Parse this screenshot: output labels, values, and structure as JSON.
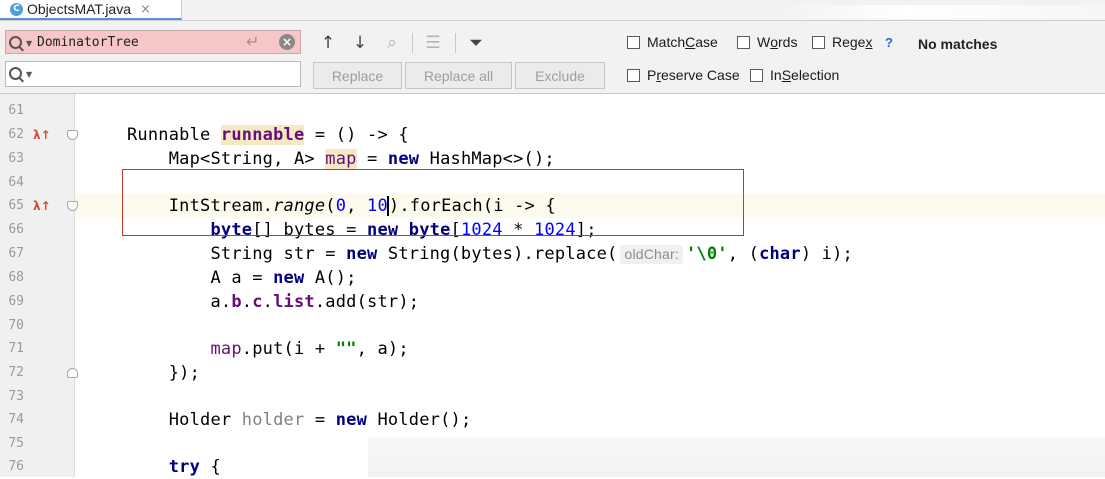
{
  "tab": {
    "file_icon_letter": "C",
    "title": "ObjectsMAT.java",
    "close_glyph": "×",
    "icon": "java-class-icon"
  },
  "find": {
    "search_value": "DominatorTree",
    "replace_value": "",
    "enter_glyph": "↵",
    "clear_glyph": "×",
    "tools": {
      "prev_glyph": "↑",
      "next_glyph": "↓",
      "find_all_glyph": "⌕",
      "select_all_glyph": "☰",
      "filter_glyph": "⏷"
    },
    "replace_label": "Replace",
    "replace_all_label": "Replace all",
    "exclude_label": "Exclude",
    "options": {
      "match_case": {
        "pre": "Match ",
        "u": "C",
        "post": "ase"
      },
      "words": {
        "pre": "W",
        "u": "o",
        "post": "rds"
      },
      "regex": {
        "pre": "Rege",
        "u": "x",
        "post": ""
      },
      "preserve_case": {
        "pre": "P",
        "u": "r",
        "post": "eserve Case"
      },
      "in_selection": {
        "pre": "In ",
        "u": "S",
        "post": "election"
      }
    },
    "regex_help": "?",
    "status": "No matches"
  },
  "gutter": {
    "lambda_glyph": "λ↑"
  },
  "editor": {
    "lines": [
      {
        "n": "61"
      },
      {
        "n": "62",
        "t1": "Runnable ",
        "hl1": "runnable",
        "t2": " = () -> {"
      },
      {
        "n": "63",
        "t1": "    Map<String, A> ",
        "hl1": "map",
        "t2": " = ",
        "kw1": "new",
        "t3": " HashMap<>();"
      },
      {
        "n": "64"
      },
      {
        "n": "65",
        "t1": "    IntStream.",
        "it": "range",
        "t2": "(",
        "n1": "0",
        "t3": ", ",
        "n2a": "10",
        "t4": ").forEach(i -> {"
      },
      {
        "n": "66",
        "t0": "        ",
        "kw1": "byte",
        "t1": "[] bytes = ",
        "kw2": "new",
        "t2": " ",
        "kw3": "byte",
        "t3": "[",
        "n1": "1024",
        "t4": " * ",
        "n2": "1024",
        "t5": "];"
      },
      {
        "n": "67",
        "t1": "        String str = ",
        "kw1": "new",
        "t2": " String(bytes).replace(",
        "inlay": "oldChar:",
        "s1": "'\\0'",
        "t3": ", (",
        "kw2": "char",
        "t4": ") i);"
      },
      {
        "n": "68",
        "t1": "        A a = ",
        "kw1": "new",
        "t2": " A();"
      },
      {
        "n": "69",
        "t1": "        a.",
        "f1": "b",
        "t2": ".",
        "f2": "c",
        "t3": ".",
        "f3": "list",
        "t4": ".add(str);"
      },
      {
        "n": "70"
      },
      {
        "n": "71",
        "t0": "        ",
        "fp": "map",
        "t1": ".put(i + ",
        "s1": "\"\"",
        "t2": ", a);"
      },
      {
        "n": "72",
        "t1": "    });"
      },
      {
        "n": "73"
      },
      {
        "n": "74",
        "t1": "    Holder ",
        "un": "holder",
        "t2": " = ",
        "kw1": "new",
        "t3": " Holder();"
      },
      {
        "n": "75"
      },
      {
        "n": "76",
        "t0": "    ",
        "kw1": "try",
        "t1": " {"
      }
    ]
  }
}
